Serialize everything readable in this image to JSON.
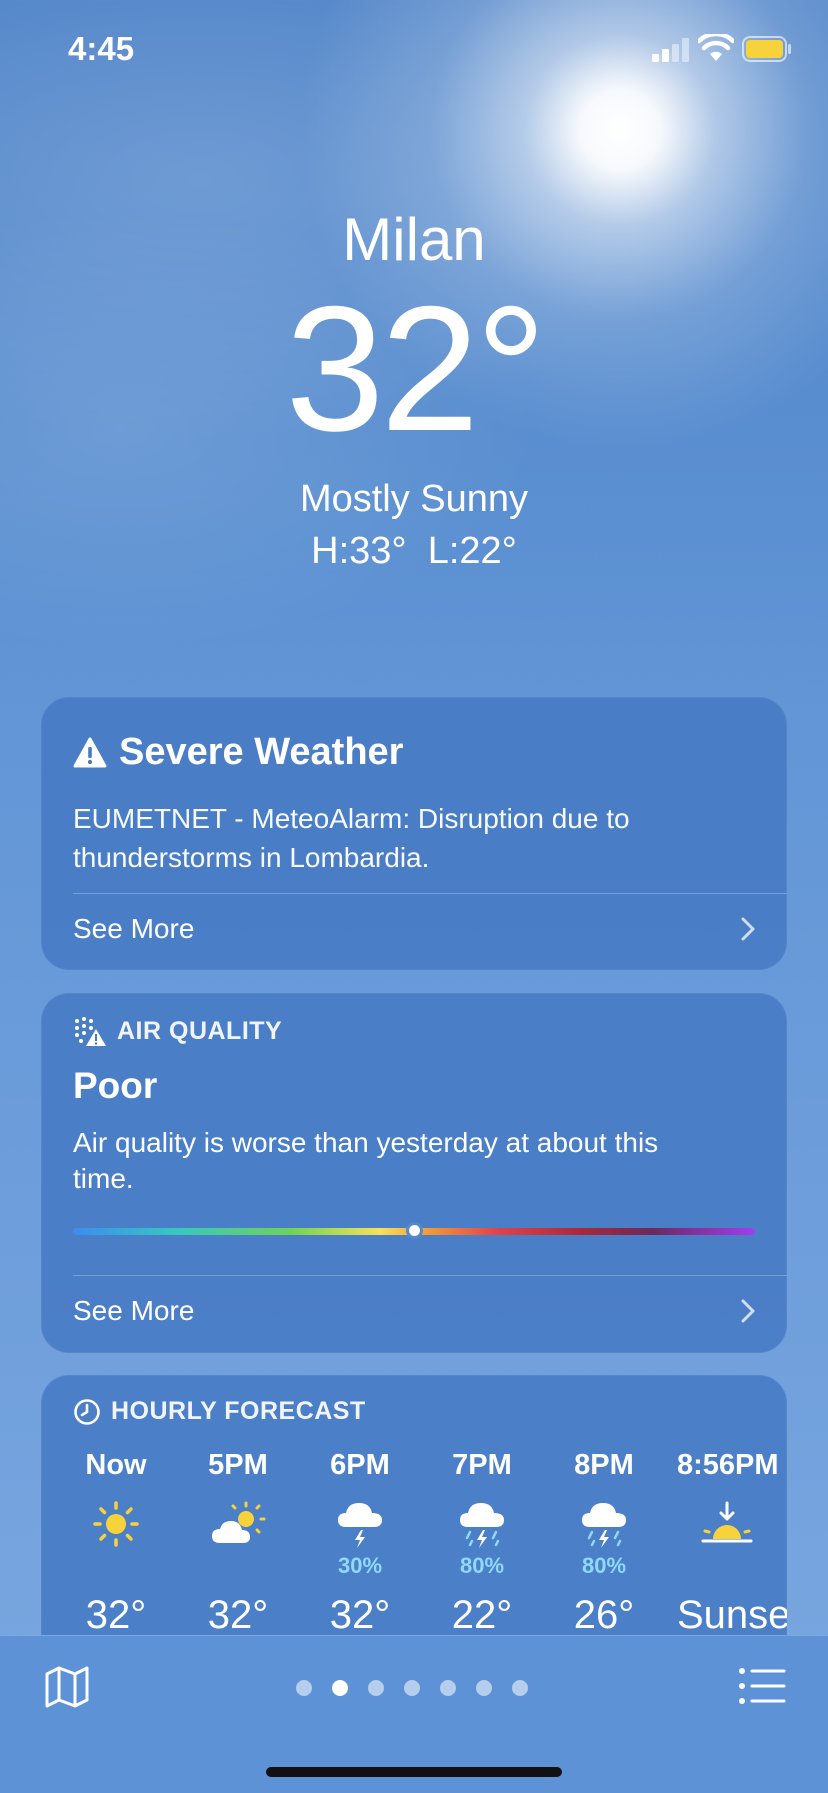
{
  "status_bar": {
    "time": "4:45"
  },
  "location": {
    "city": "Milan",
    "temperature": "32°",
    "condition": "Mostly Sunny",
    "high_low": "H:33°  L:22°"
  },
  "severe_weather": {
    "title": "Severe Weather",
    "body": "EUMETNET - MeteoAlarm: Disruption due to thunderstorms in Lombardia.",
    "see_more": "See More"
  },
  "air_quality": {
    "header": "AIR QUALITY",
    "level": "Poor",
    "description": "Air quality is worse than yesterday at about this time.",
    "index_position": 0.5,
    "see_more": "See More"
  },
  "hourly_forecast": {
    "header": "HOURLY FORECAST",
    "hours": [
      {
        "label": "Now",
        "icon": "sun-icon",
        "precip": "",
        "temp": "32°"
      },
      {
        "label": "5PM",
        "icon": "partly-sunny-icon",
        "precip": "",
        "temp": "32°"
      },
      {
        "label": "6PM",
        "icon": "thunderstorm-icon",
        "precip": "30%",
        "temp": "32°"
      },
      {
        "label": "7PM",
        "icon": "thunderstorm-rain-icon",
        "precip": "80%",
        "temp": "22°"
      },
      {
        "label": "8PM",
        "icon": "thunderstorm-rain-icon",
        "precip": "80%",
        "temp": "26°"
      },
      {
        "label": "8:56PM",
        "icon": "sunset-icon",
        "precip": "",
        "temp": "Sunset"
      }
    ]
  },
  "toolbar": {
    "page_count": 7,
    "active_page": 2
  },
  "colors": {
    "card_bg": "#467ac4",
    "precip": "#8fd8ff",
    "sun": "#f7d23a",
    "battery": "#f7d23a"
  }
}
